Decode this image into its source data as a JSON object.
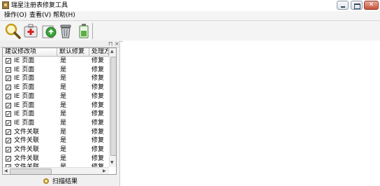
{
  "window": {
    "title": "瑞星注册表修复工具"
  },
  "menu": [
    "操作(O)",
    "查看(V)",
    "帮助(H)"
  ],
  "toolbar": [
    {
      "icon": "magnifier-icon"
    },
    {
      "icon": "first-aid-icon"
    },
    {
      "icon": "restore-icon"
    },
    {
      "icon": "trash-icon"
    },
    {
      "icon": "battery-icon"
    }
  ],
  "list": {
    "columns": [
      "建议修改项",
      "默认修复",
      "处理方"
    ],
    "rows": [
      {
        "checked": true,
        "item": "IE 页面",
        "default_fix": "是",
        "action": "修复"
      },
      {
        "checked": true,
        "item": "IE 页面",
        "default_fix": "是",
        "action": "修复"
      },
      {
        "checked": true,
        "item": "IE 页面",
        "default_fix": "是",
        "action": "修复"
      },
      {
        "checked": true,
        "item": "IE 页面",
        "default_fix": "是",
        "action": "修复"
      },
      {
        "checked": true,
        "item": "IE 页面",
        "default_fix": "是",
        "action": "修复"
      },
      {
        "checked": true,
        "item": "IE 页面",
        "default_fix": "是",
        "action": "修复"
      },
      {
        "checked": true,
        "item": "IE 页面",
        "default_fix": "是",
        "action": "修复"
      },
      {
        "checked": true,
        "item": "IE 页面",
        "default_fix": "是",
        "action": "修复"
      },
      {
        "checked": true,
        "item": "文件关联",
        "default_fix": "是",
        "action": "修复"
      },
      {
        "checked": true,
        "item": "文件关联",
        "default_fix": "是",
        "action": "修复"
      },
      {
        "checked": true,
        "item": "文件关联",
        "default_fix": "是",
        "action": "修复"
      },
      {
        "checked": true,
        "item": "文件关联",
        "default_fix": "是",
        "action": "修复"
      },
      {
        "checked": true,
        "item": "文件关联",
        "default_fix": "是",
        "action": "修复"
      }
    ]
  },
  "scan_button": {
    "label": "扫描结果"
  }
}
